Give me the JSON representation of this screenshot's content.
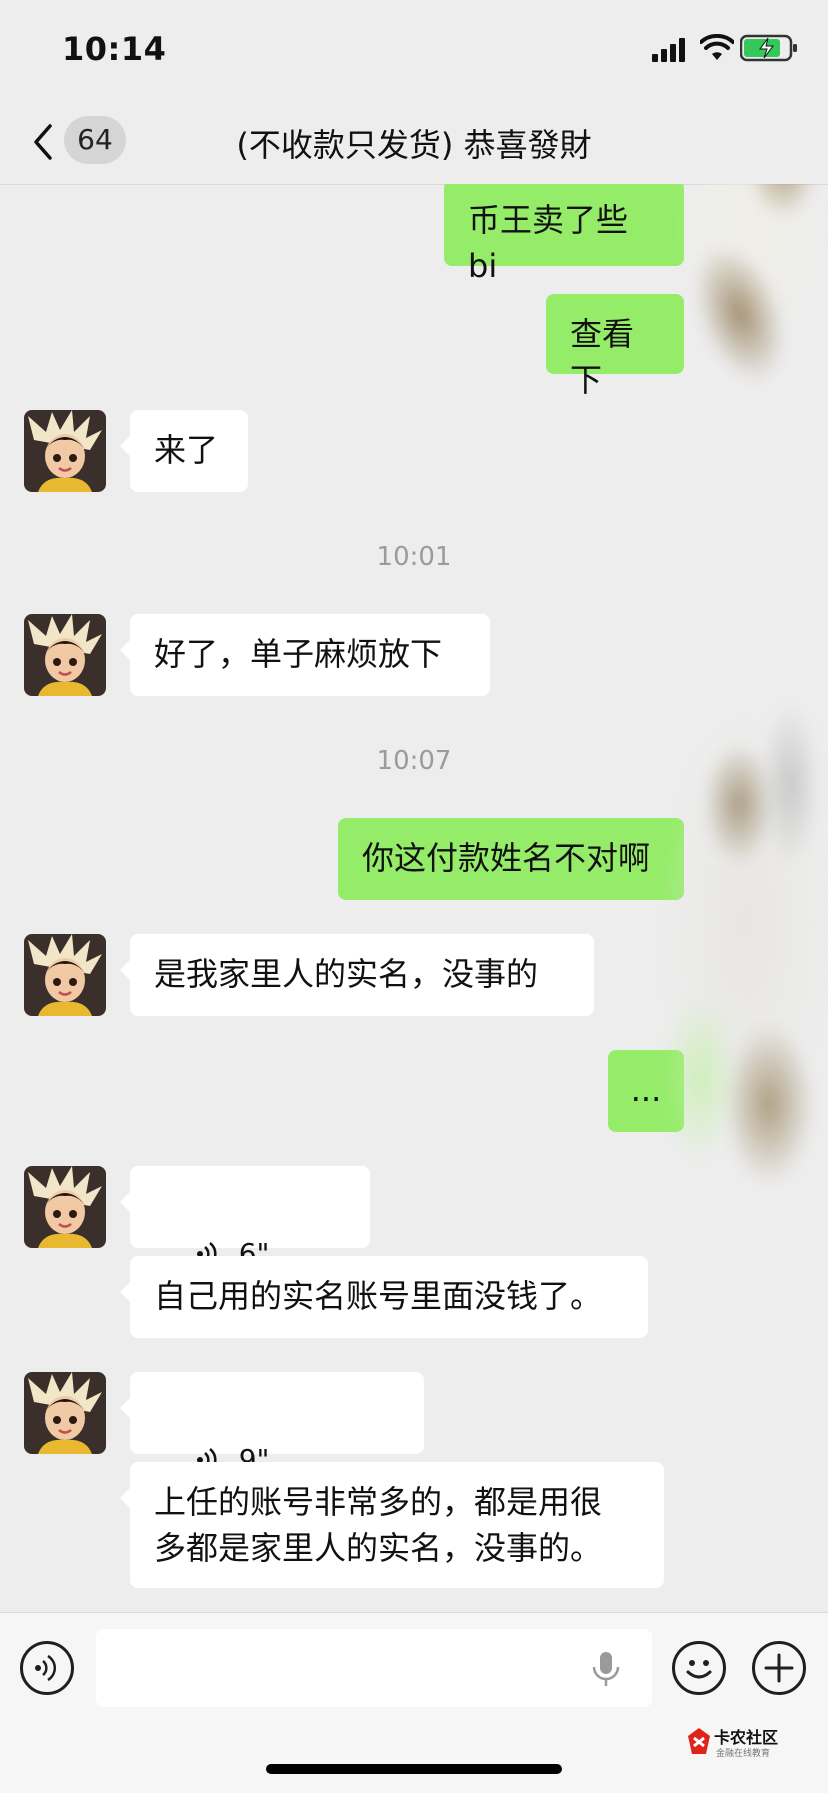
{
  "status_bar": {
    "time": "10:14"
  },
  "nav": {
    "unread_count": "64",
    "title": "(不收款只发货) 恭喜發財"
  },
  "messages": {
    "m1": "币王卖了些 bi",
    "m2": "查看下",
    "m3": "来了",
    "t1": "10:01",
    "m4": "好了，单子麻烦放下",
    "t2": "10:07",
    "m5": "你这付款姓名不对啊",
    "m6": "是我家里人的实名，没事的",
    "m7": "...",
    "v1": "6\"",
    "m8": "自己用的实名账号里面没钱了。",
    "v2": "9\"",
    "m9": "上任的账号非常多的，都是用很\n多都是家里人的实名，没事的。"
  },
  "input": {
    "placeholder": ""
  },
  "watermark": {
    "brand": "卡农社区",
    "sub": "金融在线教育"
  },
  "colors": {
    "background": "#ededed",
    "bubble_out": "#95ec69",
    "bubble_in": "#ffffff"
  }
}
